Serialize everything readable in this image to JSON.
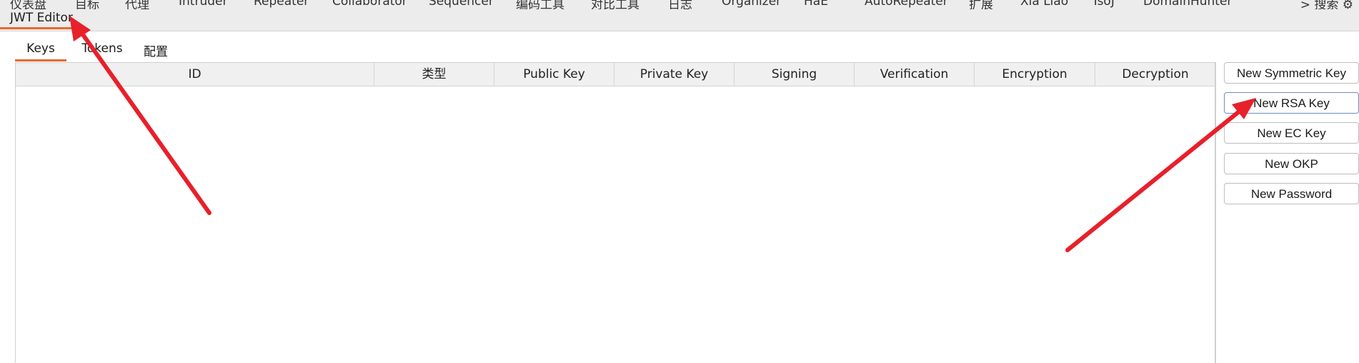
{
  "extension_tab": {
    "label": "JWT Editor"
  },
  "sub_tabs": [
    {
      "label": "Keys"
    },
    {
      "label": "Tokens"
    },
    {
      "label": "配置"
    }
  ],
  "table": {
    "columns": [
      "ID",
      "类型",
      "Public Key",
      "Private Key",
      "Signing",
      "Verification",
      "Encryption",
      "Decryption"
    ],
    "rows": []
  },
  "buttons": {
    "new_symmetric_key": "New Symmetric Key",
    "new_rsa_key": "New RSA Key",
    "new_ec_key": "New EC Key",
    "new_okp": "New OKP",
    "new_password": "New Password"
  },
  "colors": {
    "active_tab_underline": "#e8692d",
    "annotation_arrow": "#e8202a"
  }
}
